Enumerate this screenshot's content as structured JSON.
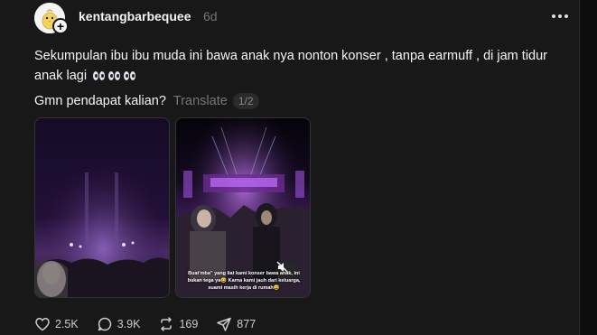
{
  "post": {
    "author": {
      "username": "kentangbarbequee",
      "avatar_icon": "chick-avatar-icon",
      "follow_icon": "plus-icon"
    },
    "timestamp": "6d",
    "text": "Sekumpulan ibu ibu muda ini bawa anak nya nonton konser , tanpa earmuff , di jam tidur anak lagi",
    "text_emoji": "eyes-emoji x3",
    "question": "Gmn pendapat kalian?",
    "translate_label": "Translate",
    "media_counter": "1/2",
    "media": [
      {
        "kind": "video-frame",
        "description_icon": "concert-crowd-image-1"
      },
      {
        "kind": "video-frame",
        "description_icon": "concert-crowd-image-2",
        "caption": "Buat'mba\" yang liat kami konser bawa anak, ini bukan tega ya😅 Karna kami jauh dari keluarga, suami masih kerja di rumah😅",
        "mute_icon": "speaker-muted-icon"
      }
    ],
    "stats": {
      "likes": "2.5K",
      "replies": "3.9K",
      "reposts": "169",
      "shares": "877"
    }
  },
  "colors": {
    "background": "#181818",
    "text_primary": "#f3f5f7",
    "text_secondary": "#777777",
    "border": "#2d2d2d"
  }
}
